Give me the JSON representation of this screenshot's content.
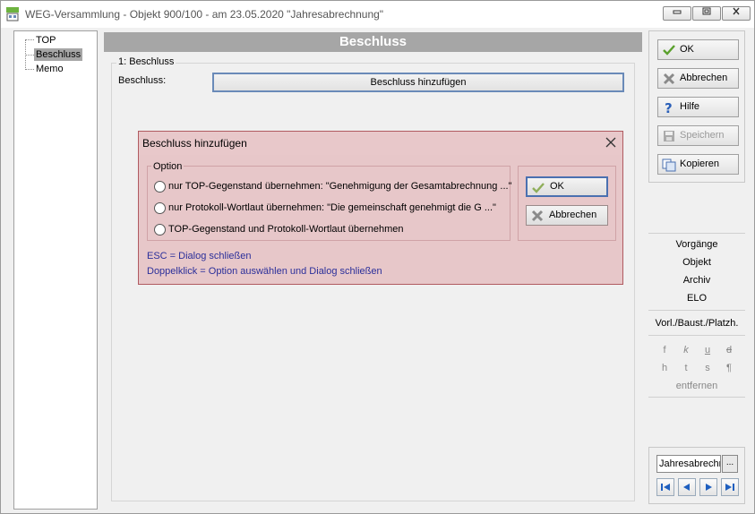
{
  "window": {
    "title": "WEG-Versammlung - Objekt 900/100 - am 23.05.2020 \"Jahresabrechnung\"",
    "minimize": "▭",
    "maximize": "□",
    "close": "✕"
  },
  "tree": {
    "items": [
      {
        "label": "TOP",
        "selected": false
      },
      {
        "label": "Beschluss",
        "selected": true
      },
      {
        "label": "Memo",
        "selected": false
      }
    ]
  },
  "main": {
    "header": "Beschluss",
    "group_label": "1: Beschluss",
    "field_label": "Beschluss:",
    "add_button": "Beschluss hinzufügen"
  },
  "sidebar": {
    "ok": "OK",
    "cancel": "Abbrechen",
    "help": "Hilfe",
    "save": "Speichern",
    "copy": "Kopieren"
  },
  "sidepanel": {
    "links": [
      "Vorgänge",
      "Objekt",
      "Archiv",
      "ELO"
    ],
    "vorl": "Vorl./Baust./Platzh.",
    "format_row1": [
      "f",
      "k",
      "u",
      "d"
    ],
    "format_row2": [
      "h",
      "t",
      "s",
      "¶"
    ],
    "remove": "entfernen"
  },
  "bottom": {
    "combo_value": "Jahresabrechn",
    "combo_button": "...",
    "nav": [
      "first",
      "prev",
      "next",
      "last"
    ]
  },
  "dialog": {
    "title": "Beschluss hinzufügen",
    "option_label": "Option",
    "options": [
      "nur TOP-Gegenstand übernehmen: \"Genehmigung der Gesamtabrechnung ...\"",
      "nur Protokoll-Wortlaut übernehmen: \"Die gemeinschaft genehmigt die G ...\"",
      "TOP-Gegenstand und Protokoll-Wortlaut übernehmen"
    ],
    "ok": "OK",
    "cancel": "Abbrechen",
    "hint1": "ESC = Dialog schließen",
    "hint2": "Doppelklick = Option auswählen und Dialog schließen"
  },
  "colors": {
    "dialog_bg": "#e7c7c9",
    "header_bg": "#a6a6a6",
    "hint_text": "#2b2f9a",
    "accent_border": "#4a70b0"
  }
}
